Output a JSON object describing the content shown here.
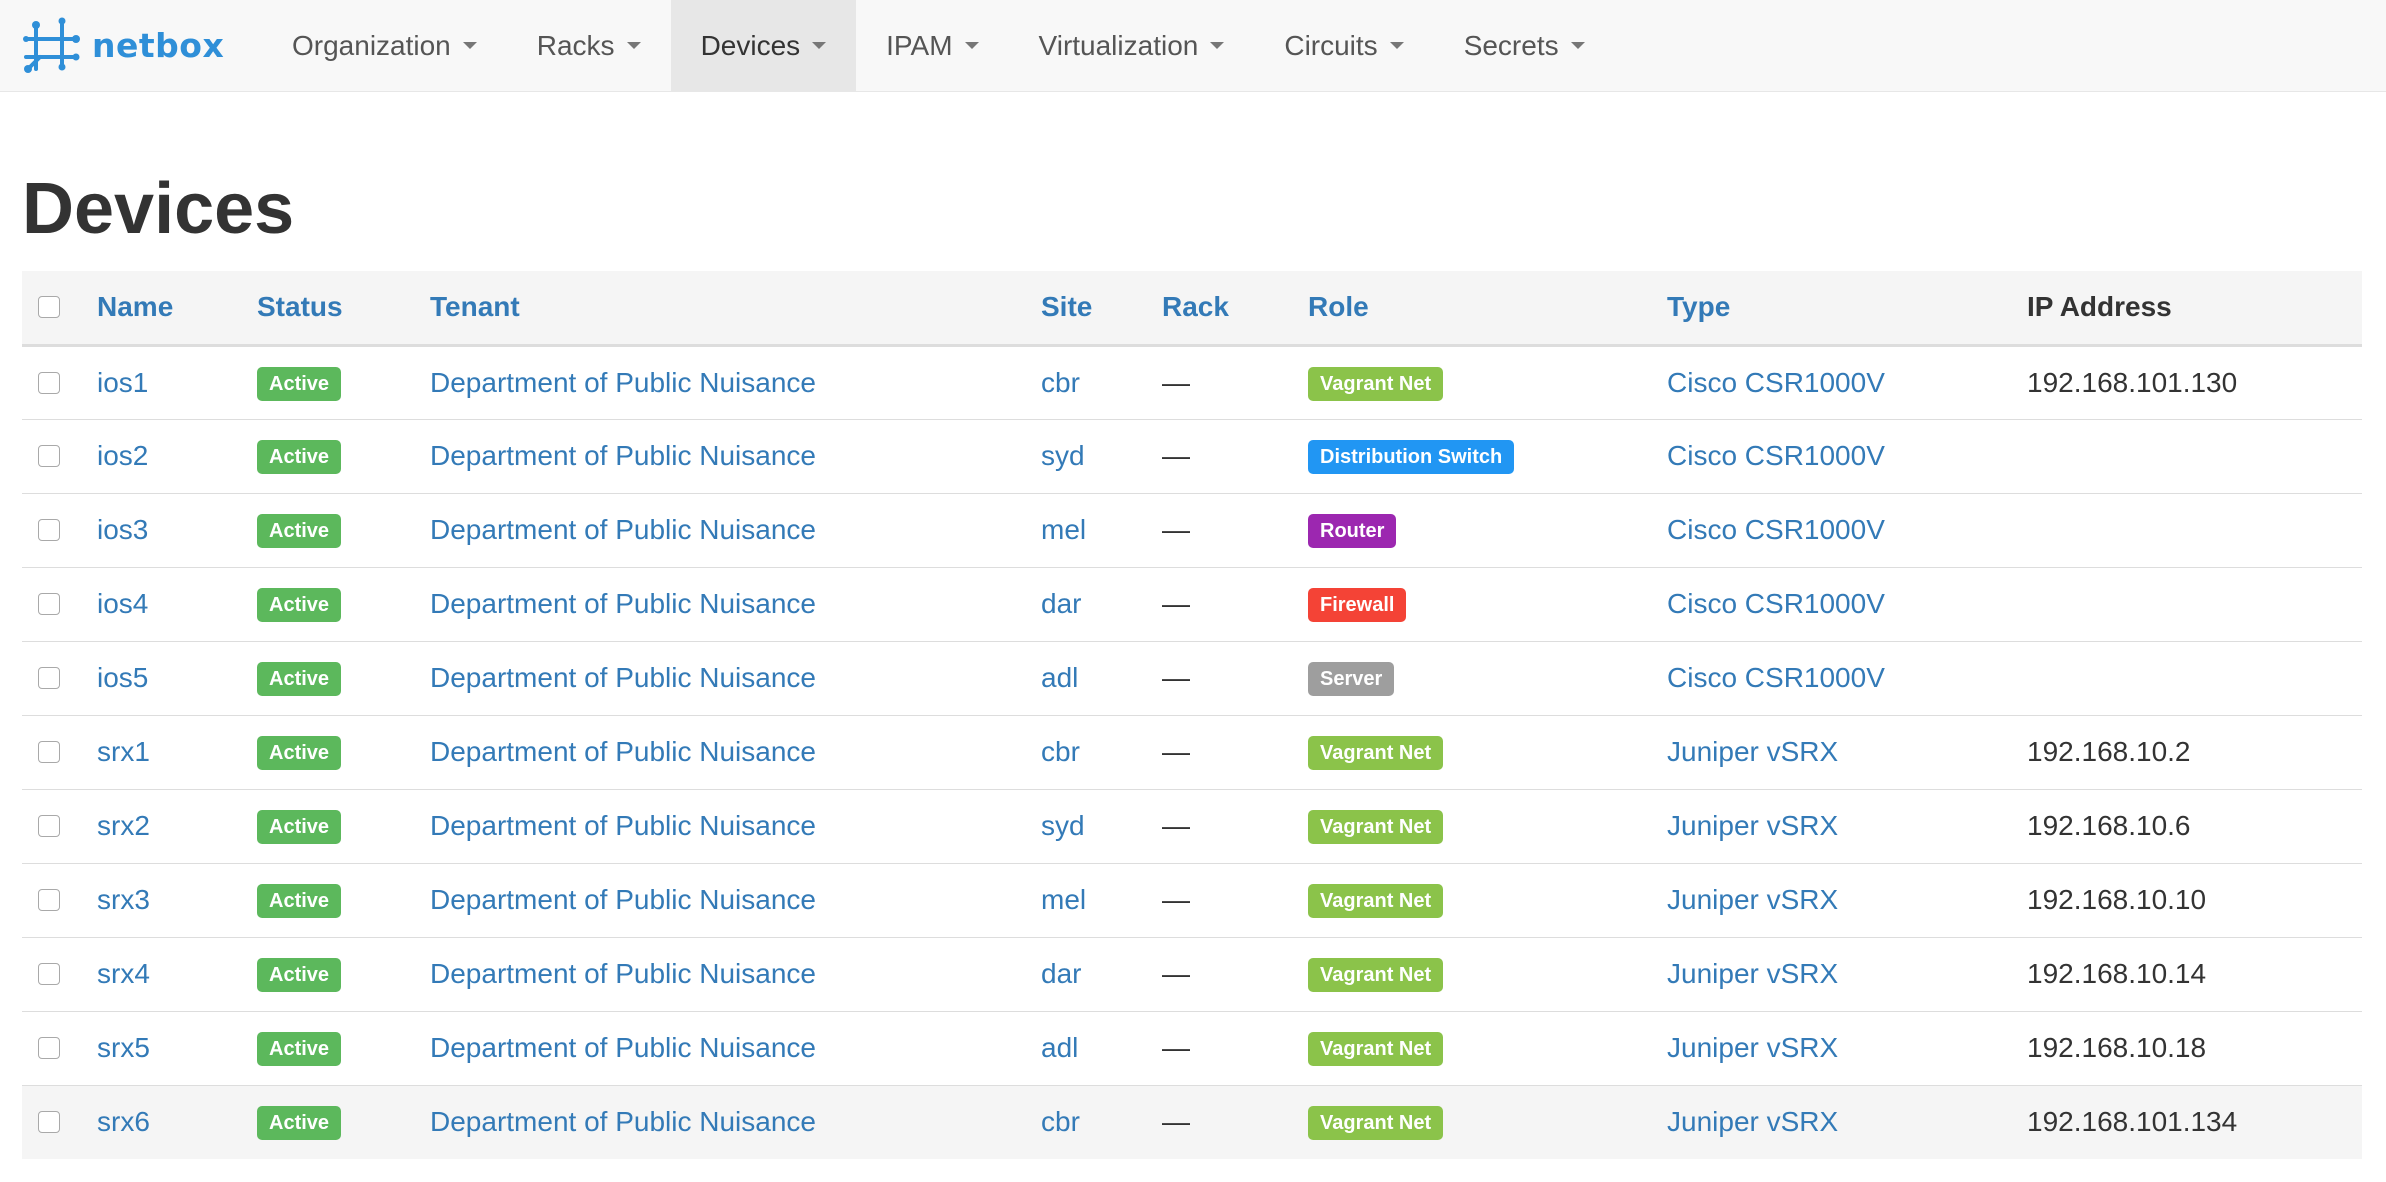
{
  "brand": {
    "name": "netbox"
  },
  "nav": [
    {
      "label": "Organization"
    },
    {
      "label": "Racks"
    },
    {
      "label": "Devices"
    },
    {
      "label": "IPAM"
    },
    {
      "label": "Virtualization"
    },
    {
      "label": "Circuits"
    },
    {
      "label": "Secrets"
    }
  ],
  "page": {
    "title": "Devices"
  },
  "table": {
    "headers": {
      "name": "Name",
      "status": "Status",
      "tenant": "Tenant",
      "site": "Site",
      "rack": "Rack",
      "role": "Role",
      "type": "Type",
      "ip": "IP Address"
    },
    "rows": [
      {
        "name": "ios1",
        "status": "Active",
        "tenant": "Department of Public Nuisance",
        "site": "cbr",
        "rack": "—",
        "role": "Vagrant Net",
        "role_color": "#8bc34a",
        "type": "Cisco CSR1000V",
        "ip": "192.168.101.130"
      },
      {
        "name": "ios2",
        "status": "Active",
        "tenant": "Department of Public Nuisance",
        "site": "syd",
        "rack": "—",
        "role": "Distribution Switch",
        "role_color": "#2196f3",
        "type": "Cisco CSR1000V",
        "ip": ""
      },
      {
        "name": "ios3",
        "status": "Active",
        "tenant": "Department of Public Nuisance",
        "site": "mel",
        "rack": "—",
        "role": "Router",
        "role_color": "#9c27b0",
        "type": "Cisco CSR1000V",
        "ip": ""
      },
      {
        "name": "ios4",
        "status": "Active",
        "tenant": "Department of Public Nuisance",
        "site": "dar",
        "rack": "—",
        "role": "Firewall",
        "role_color": "#f44336",
        "type": "Cisco CSR1000V",
        "ip": ""
      },
      {
        "name": "ios5",
        "status": "Active",
        "tenant": "Department of Public Nuisance",
        "site": "adl",
        "rack": "—",
        "role": "Server",
        "role_color": "#9e9e9e",
        "type": "Cisco CSR1000V",
        "ip": ""
      },
      {
        "name": "srx1",
        "status": "Active",
        "tenant": "Department of Public Nuisance",
        "site": "cbr",
        "rack": "—",
        "role": "Vagrant Net",
        "role_color": "#8bc34a",
        "type": "Juniper vSRX",
        "ip": "192.168.10.2"
      },
      {
        "name": "srx2",
        "status": "Active",
        "tenant": "Department of Public Nuisance",
        "site": "syd",
        "rack": "—",
        "role": "Vagrant Net",
        "role_color": "#8bc34a",
        "type": "Juniper vSRX",
        "ip": "192.168.10.6"
      },
      {
        "name": "srx3",
        "status": "Active",
        "tenant": "Department of Public Nuisance",
        "site": "mel",
        "rack": "—",
        "role": "Vagrant Net",
        "role_color": "#8bc34a",
        "type": "Juniper vSRX",
        "ip": "192.168.10.10"
      },
      {
        "name": "srx4",
        "status": "Active",
        "tenant": "Department of Public Nuisance",
        "site": "dar",
        "rack": "—",
        "role": "Vagrant Net",
        "role_color": "#8bc34a",
        "type": "Juniper vSRX",
        "ip": "192.168.10.14"
      },
      {
        "name": "srx5",
        "status": "Active",
        "tenant": "Department of Public Nuisance",
        "site": "adl",
        "rack": "—",
        "role": "Vagrant Net",
        "role_color": "#8bc34a",
        "type": "Juniper vSRX",
        "ip": "192.168.10.18"
      },
      {
        "name": "srx6",
        "status": "Active",
        "tenant": "Department of Public Nuisance",
        "site": "cbr",
        "rack": "—",
        "role": "Vagrant Net",
        "role_color": "#8bc34a",
        "type": "Juniper vSRX",
        "ip": "192.168.101.134"
      }
    ]
  },
  "colors": {
    "status_active": "#5cb85c",
    "link": "#337ab7"
  }
}
